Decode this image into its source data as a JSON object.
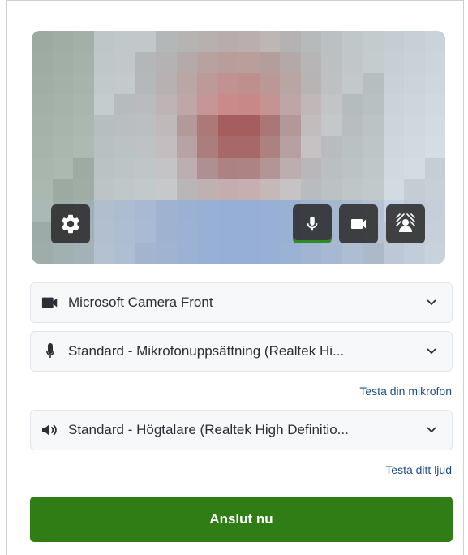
{
  "preview": {
    "mic_level": 1.0
  },
  "controls": {
    "settings_icon": "gear-icon",
    "mic_icon": "microphone-icon",
    "camera_icon": "video-camera-icon",
    "background_icon": "background-effects-icon"
  },
  "devices": {
    "camera": {
      "icon": "video-camera-icon",
      "value": "Microsoft Camera Front"
    },
    "microphone": {
      "icon": "microphone-icon",
      "value": "Standard - Mikrofonuppsättning (Realtek Hi..."
    },
    "speaker": {
      "icon": "speaker-icon",
      "value": "Standard - Högtalare (Realtek High Definitio..."
    }
  },
  "links": {
    "test_microphone": "Testa din mikrofon",
    "test_sound": "Testa ditt ljud"
  },
  "join_button": {
    "label": "Anslut nu",
    "color": "#2f7d14"
  },
  "colors": {
    "accent": "#2f7d14",
    "link": "#1f4e8c",
    "mic_active": "#2e8b1f"
  }
}
